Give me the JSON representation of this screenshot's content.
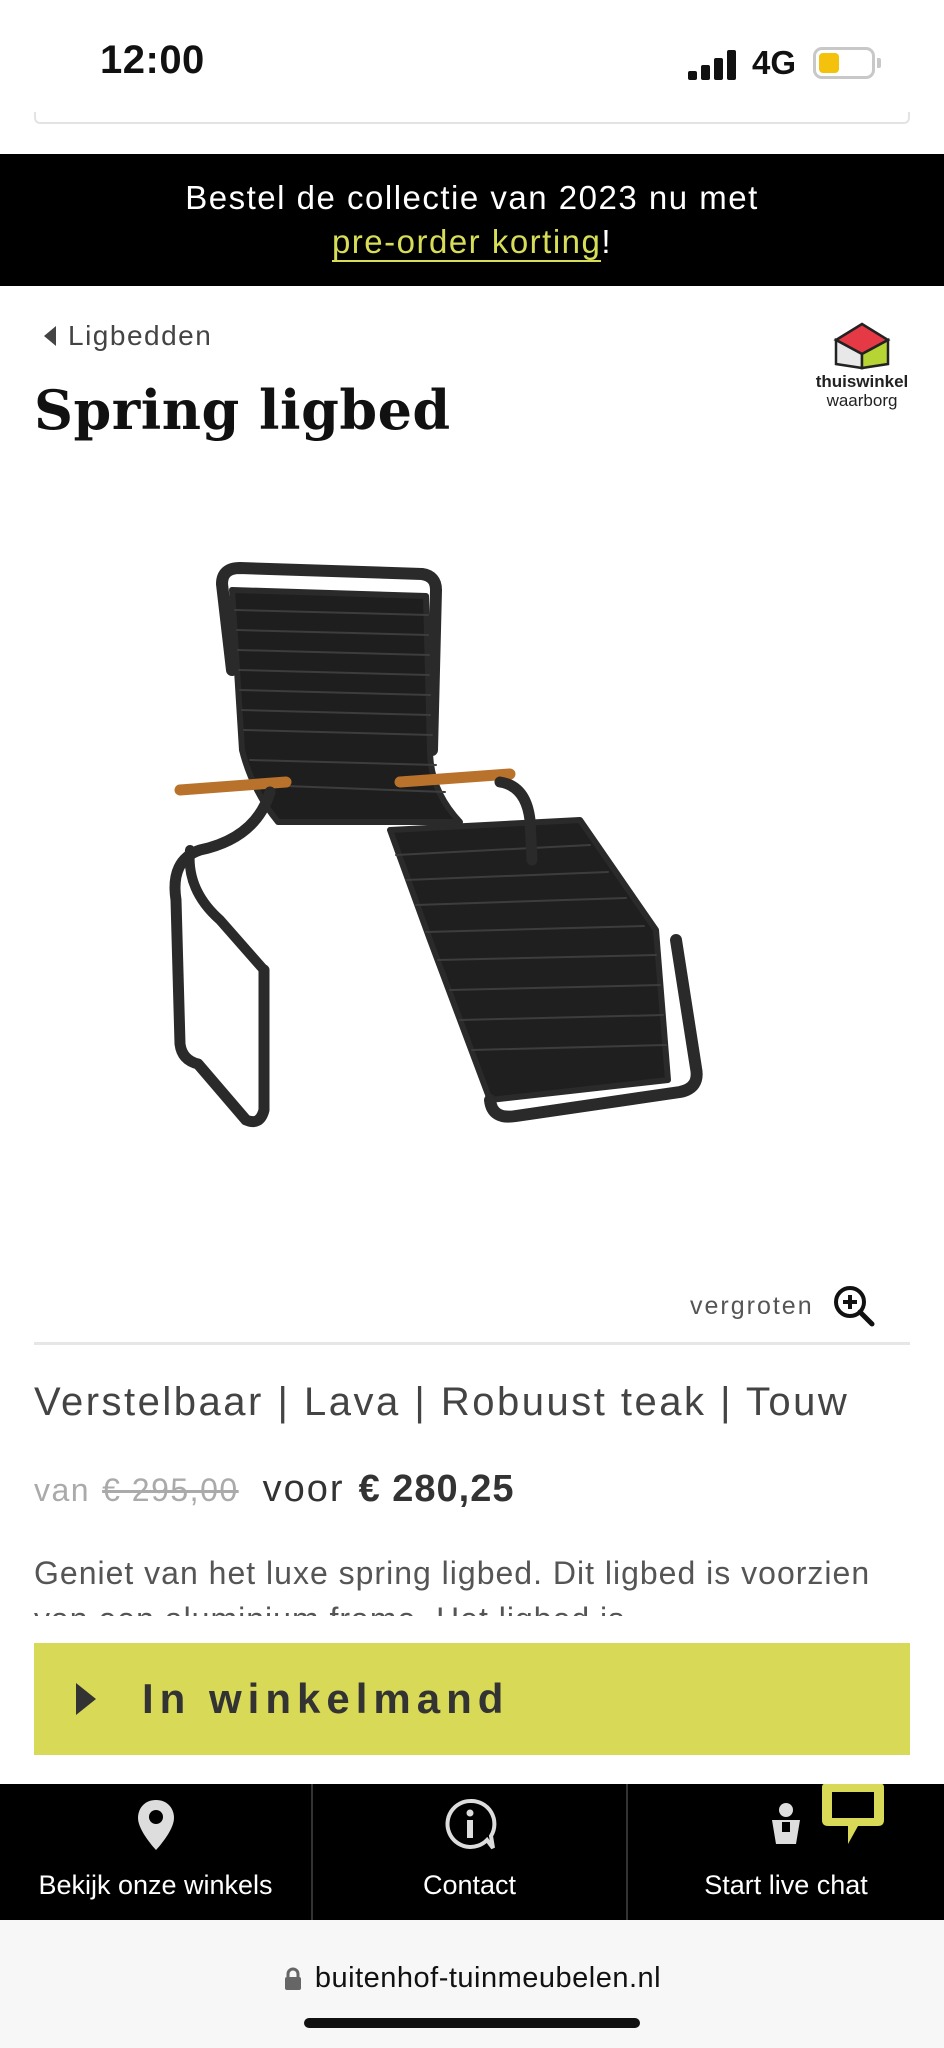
{
  "status_bar": {
    "time": "12:00",
    "network": "4G"
  },
  "promo": {
    "text_before": "Bestel de collectie van 2023 nu met",
    "link": "pre-order korting",
    "text_after": "!"
  },
  "breadcrumb": {
    "label": "Ligbedden"
  },
  "product": {
    "title": "Spring ligbed",
    "zoom_label": "vergroten",
    "subtitle": "Verstelbaar | Lava | Robuust teak | Touw",
    "price_from_label": "van",
    "price_old": "€ 295,00",
    "price_for_label": "voor",
    "price_new": "€ 280,25",
    "description": "Geniet van het luxe spring ligbed. Dit ligbed is voorzien van een aluminium frame. Het ligbed is"
  },
  "trust_badge": {
    "name": "thuiswinkel",
    "sub": "waarborg"
  },
  "cart_button": {
    "label": "In winkelmand"
  },
  "bottom_nav": {
    "items": [
      {
        "label": "Bekijk onze winkels",
        "icon": "map-pin-icon"
      },
      {
        "label": "Contact",
        "icon": "info-chat-icon"
      },
      {
        "label": "Start live chat",
        "icon": "agent-icon"
      }
    ]
  },
  "browser": {
    "url": "buitenhof-tuinmeubelen.nl"
  },
  "colors": {
    "accent": "#d7d957",
    "link": "#d7dd57",
    "nav_bg": "#000000"
  }
}
